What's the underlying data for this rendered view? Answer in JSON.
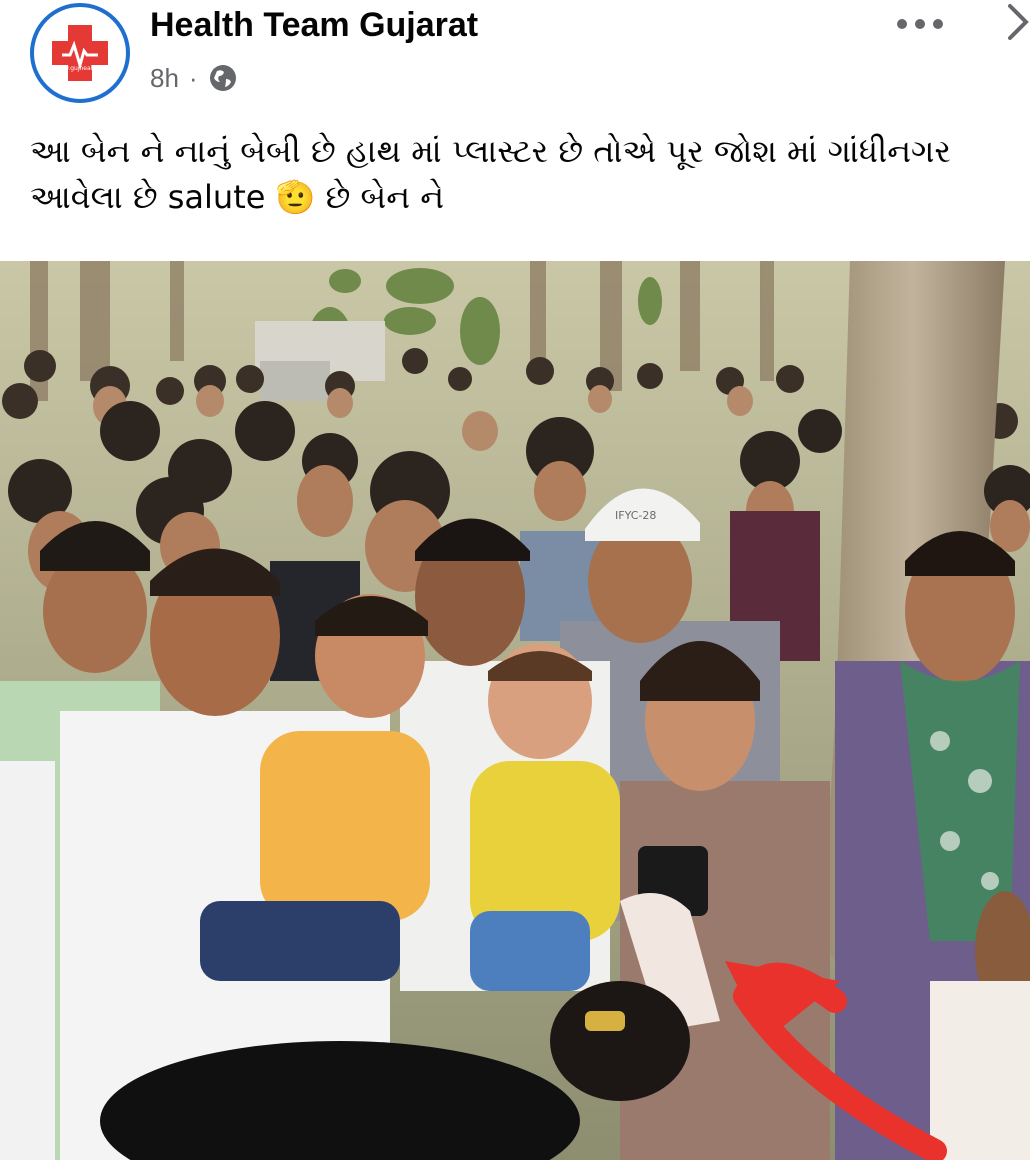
{
  "post": {
    "page_name": "Health Team Gujarat",
    "time": "8h",
    "separator": "·",
    "audience_icon": "globe-icon",
    "more_icon": "more-horizontal-icon",
    "nav_icon": "chevron-right-icon",
    "avatar_text": "www.gujhealth.in",
    "caption_line1": "આ બેન ને નાનું બેબી છે હાથ માં પ્લાસ્ટર છે તોએ પૂર જોશ માં ગાંધીનગર",
    "caption_line2_text": "આવેલા છે salute",
    "caption_line2_emoji": "🫡",
    "caption_line2_end": "છે બેન ને"
  },
  "photo": {
    "cap_text": "IFYC-28",
    "arrow_color": "#e8322b"
  },
  "colors": {
    "avatar_ring": "#1f6fd1",
    "avatar_cross": "#e53935",
    "meta_gray": "#65676b"
  }
}
